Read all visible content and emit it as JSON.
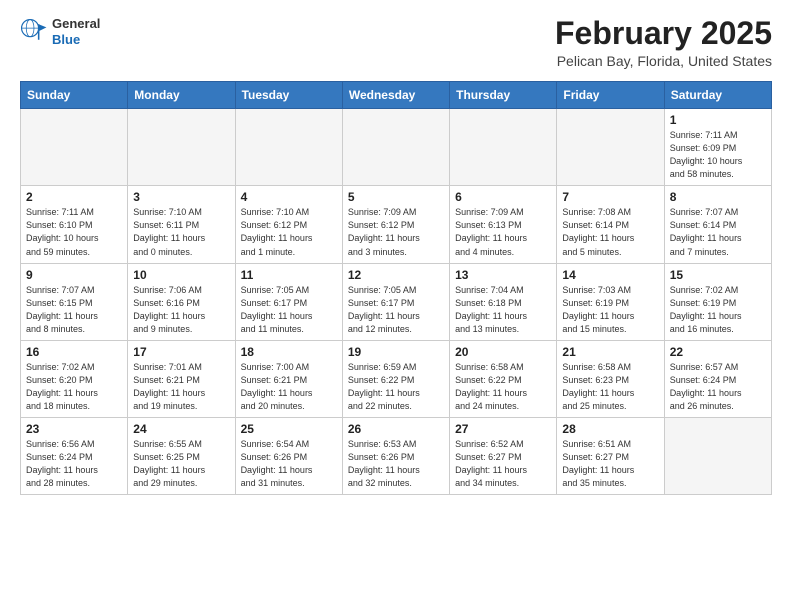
{
  "header": {
    "logo_line1": "General",
    "logo_line2": "Blue",
    "month_title": "February 2025",
    "location": "Pelican Bay, Florida, United States"
  },
  "days_of_week": [
    "Sunday",
    "Monday",
    "Tuesday",
    "Wednesday",
    "Thursday",
    "Friday",
    "Saturday"
  ],
  "weeks": [
    [
      {
        "day": "",
        "info": ""
      },
      {
        "day": "",
        "info": ""
      },
      {
        "day": "",
        "info": ""
      },
      {
        "day": "",
        "info": ""
      },
      {
        "day": "",
        "info": ""
      },
      {
        "day": "",
        "info": ""
      },
      {
        "day": "1",
        "info": "Sunrise: 7:11 AM\nSunset: 6:09 PM\nDaylight: 10 hours\nand 58 minutes."
      }
    ],
    [
      {
        "day": "2",
        "info": "Sunrise: 7:11 AM\nSunset: 6:10 PM\nDaylight: 10 hours\nand 59 minutes."
      },
      {
        "day": "3",
        "info": "Sunrise: 7:10 AM\nSunset: 6:11 PM\nDaylight: 11 hours\nand 0 minutes."
      },
      {
        "day": "4",
        "info": "Sunrise: 7:10 AM\nSunset: 6:12 PM\nDaylight: 11 hours\nand 1 minute."
      },
      {
        "day": "5",
        "info": "Sunrise: 7:09 AM\nSunset: 6:12 PM\nDaylight: 11 hours\nand 3 minutes."
      },
      {
        "day": "6",
        "info": "Sunrise: 7:09 AM\nSunset: 6:13 PM\nDaylight: 11 hours\nand 4 minutes."
      },
      {
        "day": "7",
        "info": "Sunrise: 7:08 AM\nSunset: 6:14 PM\nDaylight: 11 hours\nand 5 minutes."
      },
      {
        "day": "8",
        "info": "Sunrise: 7:07 AM\nSunset: 6:14 PM\nDaylight: 11 hours\nand 7 minutes."
      }
    ],
    [
      {
        "day": "9",
        "info": "Sunrise: 7:07 AM\nSunset: 6:15 PM\nDaylight: 11 hours\nand 8 minutes."
      },
      {
        "day": "10",
        "info": "Sunrise: 7:06 AM\nSunset: 6:16 PM\nDaylight: 11 hours\nand 9 minutes."
      },
      {
        "day": "11",
        "info": "Sunrise: 7:05 AM\nSunset: 6:17 PM\nDaylight: 11 hours\nand 11 minutes."
      },
      {
        "day": "12",
        "info": "Sunrise: 7:05 AM\nSunset: 6:17 PM\nDaylight: 11 hours\nand 12 minutes."
      },
      {
        "day": "13",
        "info": "Sunrise: 7:04 AM\nSunset: 6:18 PM\nDaylight: 11 hours\nand 13 minutes."
      },
      {
        "day": "14",
        "info": "Sunrise: 7:03 AM\nSunset: 6:19 PM\nDaylight: 11 hours\nand 15 minutes."
      },
      {
        "day": "15",
        "info": "Sunrise: 7:02 AM\nSunset: 6:19 PM\nDaylight: 11 hours\nand 16 minutes."
      }
    ],
    [
      {
        "day": "16",
        "info": "Sunrise: 7:02 AM\nSunset: 6:20 PM\nDaylight: 11 hours\nand 18 minutes."
      },
      {
        "day": "17",
        "info": "Sunrise: 7:01 AM\nSunset: 6:21 PM\nDaylight: 11 hours\nand 19 minutes."
      },
      {
        "day": "18",
        "info": "Sunrise: 7:00 AM\nSunset: 6:21 PM\nDaylight: 11 hours\nand 20 minutes."
      },
      {
        "day": "19",
        "info": "Sunrise: 6:59 AM\nSunset: 6:22 PM\nDaylight: 11 hours\nand 22 minutes."
      },
      {
        "day": "20",
        "info": "Sunrise: 6:58 AM\nSunset: 6:22 PM\nDaylight: 11 hours\nand 24 minutes."
      },
      {
        "day": "21",
        "info": "Sunrise: 6:58 AM\nSunset: 6:23 PM\nDaylight: 11 hours\nand 25 minutes."
      },
      {
        "day": "22",
        "info": "Sunrise: 6:57 AM\nSunset: 6:24 PM\nDaylight: 11 hours\nand 26 minutes."
      }
    ],
    [
      {
        "day": "23",
        "info": "Sunrise: 6:56 AM\nSunset: 6:24 PM\nDaylight: 11 hours\nand 28 minutes."
      },
      {
        "day": "24",
        "info": "Sunrise: 6:55 AM\nSunset: 6:25 PM\nDaylight: 11 hours\nand 29 minutes."
      },
      {
        "day": "25",
        "info": "Sunrise: 6:54 AM\nSunset: 6:26 PM\nDaylight: 11 hours\nand 31 minutes."
      },
      {
        "day": "26",
        "info": "Sunrise: 6:53 AM\nSunset: 6:26 PM\nDaylight: 11 hours\nand 32 minutes."
      },
      {
        "day": "27",
        "info": "Sunrise: 6:52 AM\nSunset: 6:27 PM\nDaylight: 11 hours\nand 34 minutes."
      },
      {
        "day": "28",
        "info": "Sunrise: 6:51 AM\nSunset: 6:27 PM\nDaylight: 11 hours\nand 35 minutes."
      },
      {
        "day": "",
        "info": ""
      }
    ]
  ]
}
